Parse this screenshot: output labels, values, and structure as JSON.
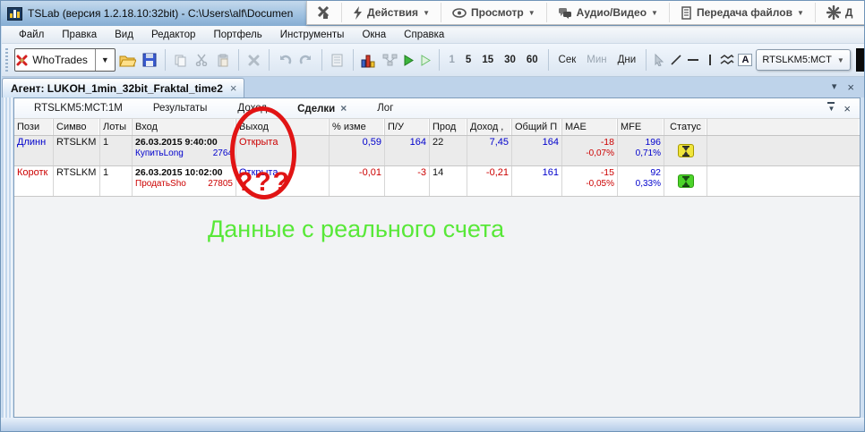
{
  "colors": {
    "profit_blue": "#0000cc",
    "loss_red": "#cc0000",
    "annotation_green": "#58e838",
    "circle_red": "#e11414",
    "status_yellow": "#f0e53c",
    "status_green": "#4cd42a",
    "titlebar_blue": "#9dc0e0"
  },
  "titlebar": {
    "title": "TSLab (версия 1.2.18.10:32bit) - C:\\Users\\alf\\Documen"
  },
  "remote_toolbar": {
    "actions": "Действия",
    "view": "Просмотр",
    "audio_video": "Аудио/Видео",
    "file_transfer": "Передача файлов",
    "more": "Д"
  },
  "menu": {
    "file": "Файл",
    "edit": "Правка",
    "view": "Вид",
    "editor": "Редактор",
    "portfolio": "Портфель",
    "tools": "Инструменты",
    "windows": "Окна",
    "help": "Справка"
  },
  "toolbar": {
    "whotrades": "WhoTrades",
    "tf1": "1",
    "tf5": "5",
    "tf15": "15",
    "tf30": "30",
    "tf60": "60",
    "sec": "Сек",
    "min": "Мин",
    "days": "Дни",
    "symbol_combo": "RTSLKM5:MCT",
    "text_tool": "A"
  },
  "agent": {
    "tab_label": "Агент: LUKOH_1min_32bit_Fraktal_time2"
  },
  "tabs": {
    "chart": "RTSLKM5:MCT:1M",
    "results": "Результаты",
    "income": "Доход",
    "trades": "Сделки",
    "log": "Лог"
  },
  "table": {
    "headers": {
      "position": "Пози",
      "symbol": "Симво",
      "lots": "Лоты",
      "entry": "Вход",
      "exit": "Выход",
      "change": "% изме",
      "pl": "П/У",
      "bars": "Прод",
      "income": "Доход ,",
      "total": "Общий П",
      "mae": "MAE",
      "mfe": "MFE",
      "status": "Статус"
    },
    "rows": [
      {
        "position": "Длинн",
        "symbol": "RTSLKM",
        "lots": "1",
        "entry_date": "26.03.2015 9:40:00",
        "entry_action": "КупитьLong",
        "entry_price": "2764",
        "exit": "Открыта",
        "change": "0,59",
        "pl": "164",
        "bars": "22",
        "income": "7,45",
        "total": "164",
        "mae": "-18",
        "mae_pct": "-0,07%",
        "mfe": "196",
        "mfe_pct": "0,71%"
      },
      {
        "position": "Коротк",
        "symbol": "RTSLKM",
        "lots": "1",
        "entry_date": "26.03.2015 10:02:00",
        "entry_action": "ПродатьSho",
        "entry_price": "27805",
        "exit": "Открыта",
        "change": "-0,01",
        "pl": "-3",
        "bars": "14",
        "income": "-0,21",
        "total": "161",
        "mae": "-15",
        "mae_pct": "-0,05%",
        "mfe": "92",
        "mfe_pct": "0,33%"
      }
    ]
  },
  "annotation": {
    "question_marks": "???",
    "note": "Данные с реального счета"
  }
}
